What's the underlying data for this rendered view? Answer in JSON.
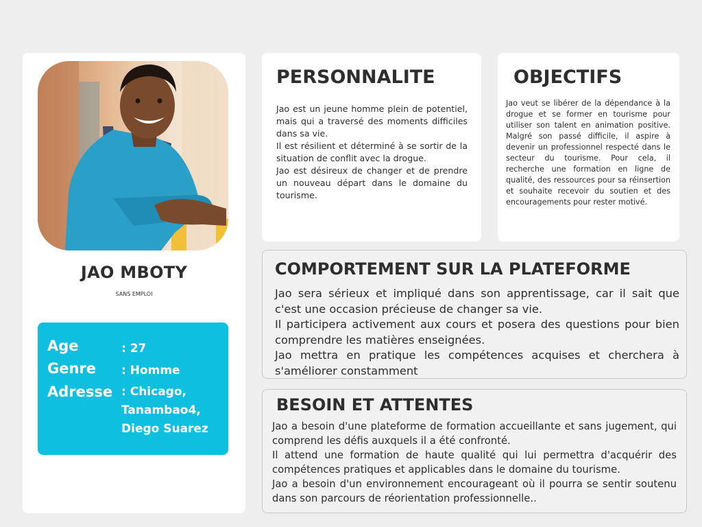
{
  "profile": {
    "name": "JAO MBOTY",
    "occupation": "SANS EMPLOI",
    "info": {
      "age_label": "Age",
      "age_value": ": 27",
      "genre_label": "Genre",
      "genre_value": ": Homme",
      "adresse_label": "Adresse",
      "adresse_lines": [
        ": Chicago,",
        "Tanambao4,",
        "Diego Suarez"
      ]
    }
  },
  "personnalite": {
    "title": "PERSONNALITE",
    "paragraphs": [
      "Jao est un jeune homme plein de potentiel, mais qui a traversé des moments difficiles dans sa vie.",
      "Il est résilient et déterminé à se sortir de la situation de conflit avec la drogue.",
      "Jao est désireux de changer et de prendre un nouveau départ dans le domaine du tourisme."
    ]
  },
  "objectifs": {
    "title": "OBJECTIFS",
    "text": "Jao veut se libérer de la dépendance à la drogue et se former en tourisme pour utiliser son talent en animation positive. Malgré son passé difficile, il aspire à devenir un professionnel respecté dans le secteur du tourisme. Pour cela, il recherche une formation en ligne de qualité, des ressources pour sa réinsertion et souhaite recevoir du soutien et des encouragements pour rester motivé."
  },
  "comportement": {
    "title": "COMPORTEMENT SUR LA PLATEFORME",
    "paragraphs": [
      "Jao sera sérieux et impliqué dans son apprentissage, car il sait que c'est une occasion précieuse de changer sa vie.",
      "Il participera activement aux cours et posera des questions pour bien comprendre les matières enseignées.",
      "Jao mettra en pratique les compétences acquises et cherchera à s'améliorer constamment"
    ]
  },
  "besoins": {
    "title": "BESOIN ET ATTENTES",
    "paragraphs": [
      "Jao a besoin d'une plateforme de formation accueillante et sans jugement, qui comprend les défis auxquels il a été confronté.",
      "Il attend une formation de haute qualité qui lui permettra d'acquérir des compétences pratiques et applicables dans le domaine du tourisme.",
      "Jao a besoin d'un environnement encourageant où il pourra se sentir soutenu dans son parcours de réorientation professionnelle.."
    ]
  },
  "colors": {
    "background": "#eeeeef",
    "info_box": "#0fbfe0",
    "card": "#ffffff",
    "text": "#2e2e2e"
  }
}
